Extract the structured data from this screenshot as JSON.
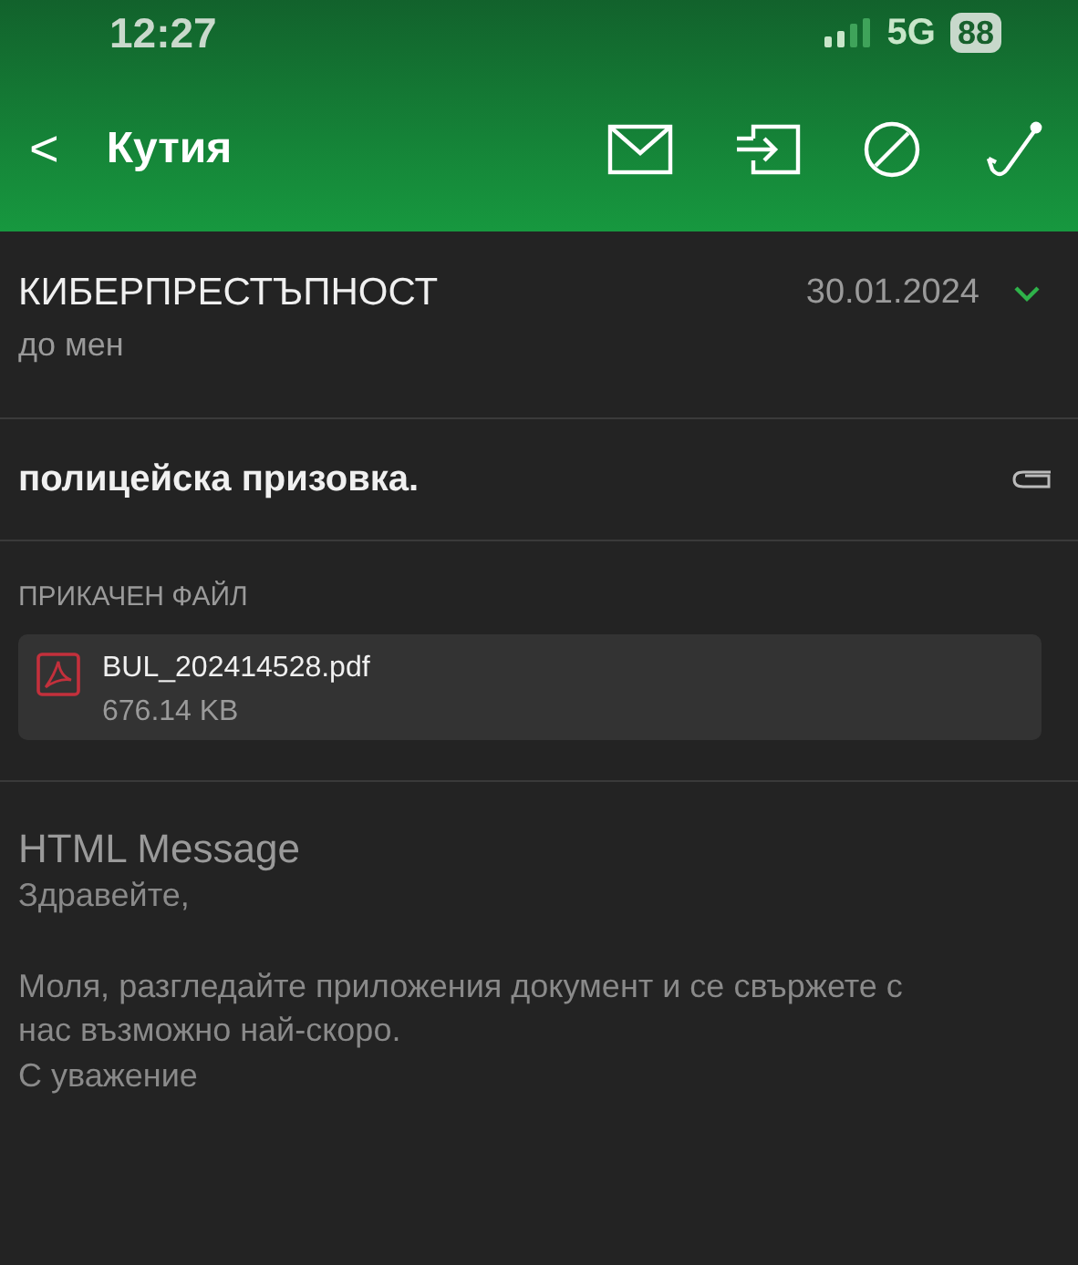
{
  "status_bar": {
    "time": "12:27",
    "network": "5G",
    "battery": "88"
  },
  "nav": {
    "back": "<",
    "title": "Кутия"
  },
  "message": {
    "sender": "КИБЕРПРЕСТЪПНОСТ",
    "recipient": "до мен",
    "date": "30.01.2024",
    "expanded": false,
    "subject": "полицейска призовка.",
    "has_attachment": true
  },
  "attachments": {
    "label": "ПРИКАЧЕН ФАЙЛ",
    "files": [
      {
        "name": "BUL_202414528.pdf",
        "size": "676.14 KB"
      }
    ]
  },
  "body": {
    "heading": "HTML Message",
    "paragraphs": [
      {
        "lines": [
          "Здравейте,"
        ]
      },
      {
        "lines": [
          "Моля, разгледайте приложения документ и се свържете с",
          "нас възможно най-скоро.",
          "С уважение"
        ]
      }
    ]
  }
}
